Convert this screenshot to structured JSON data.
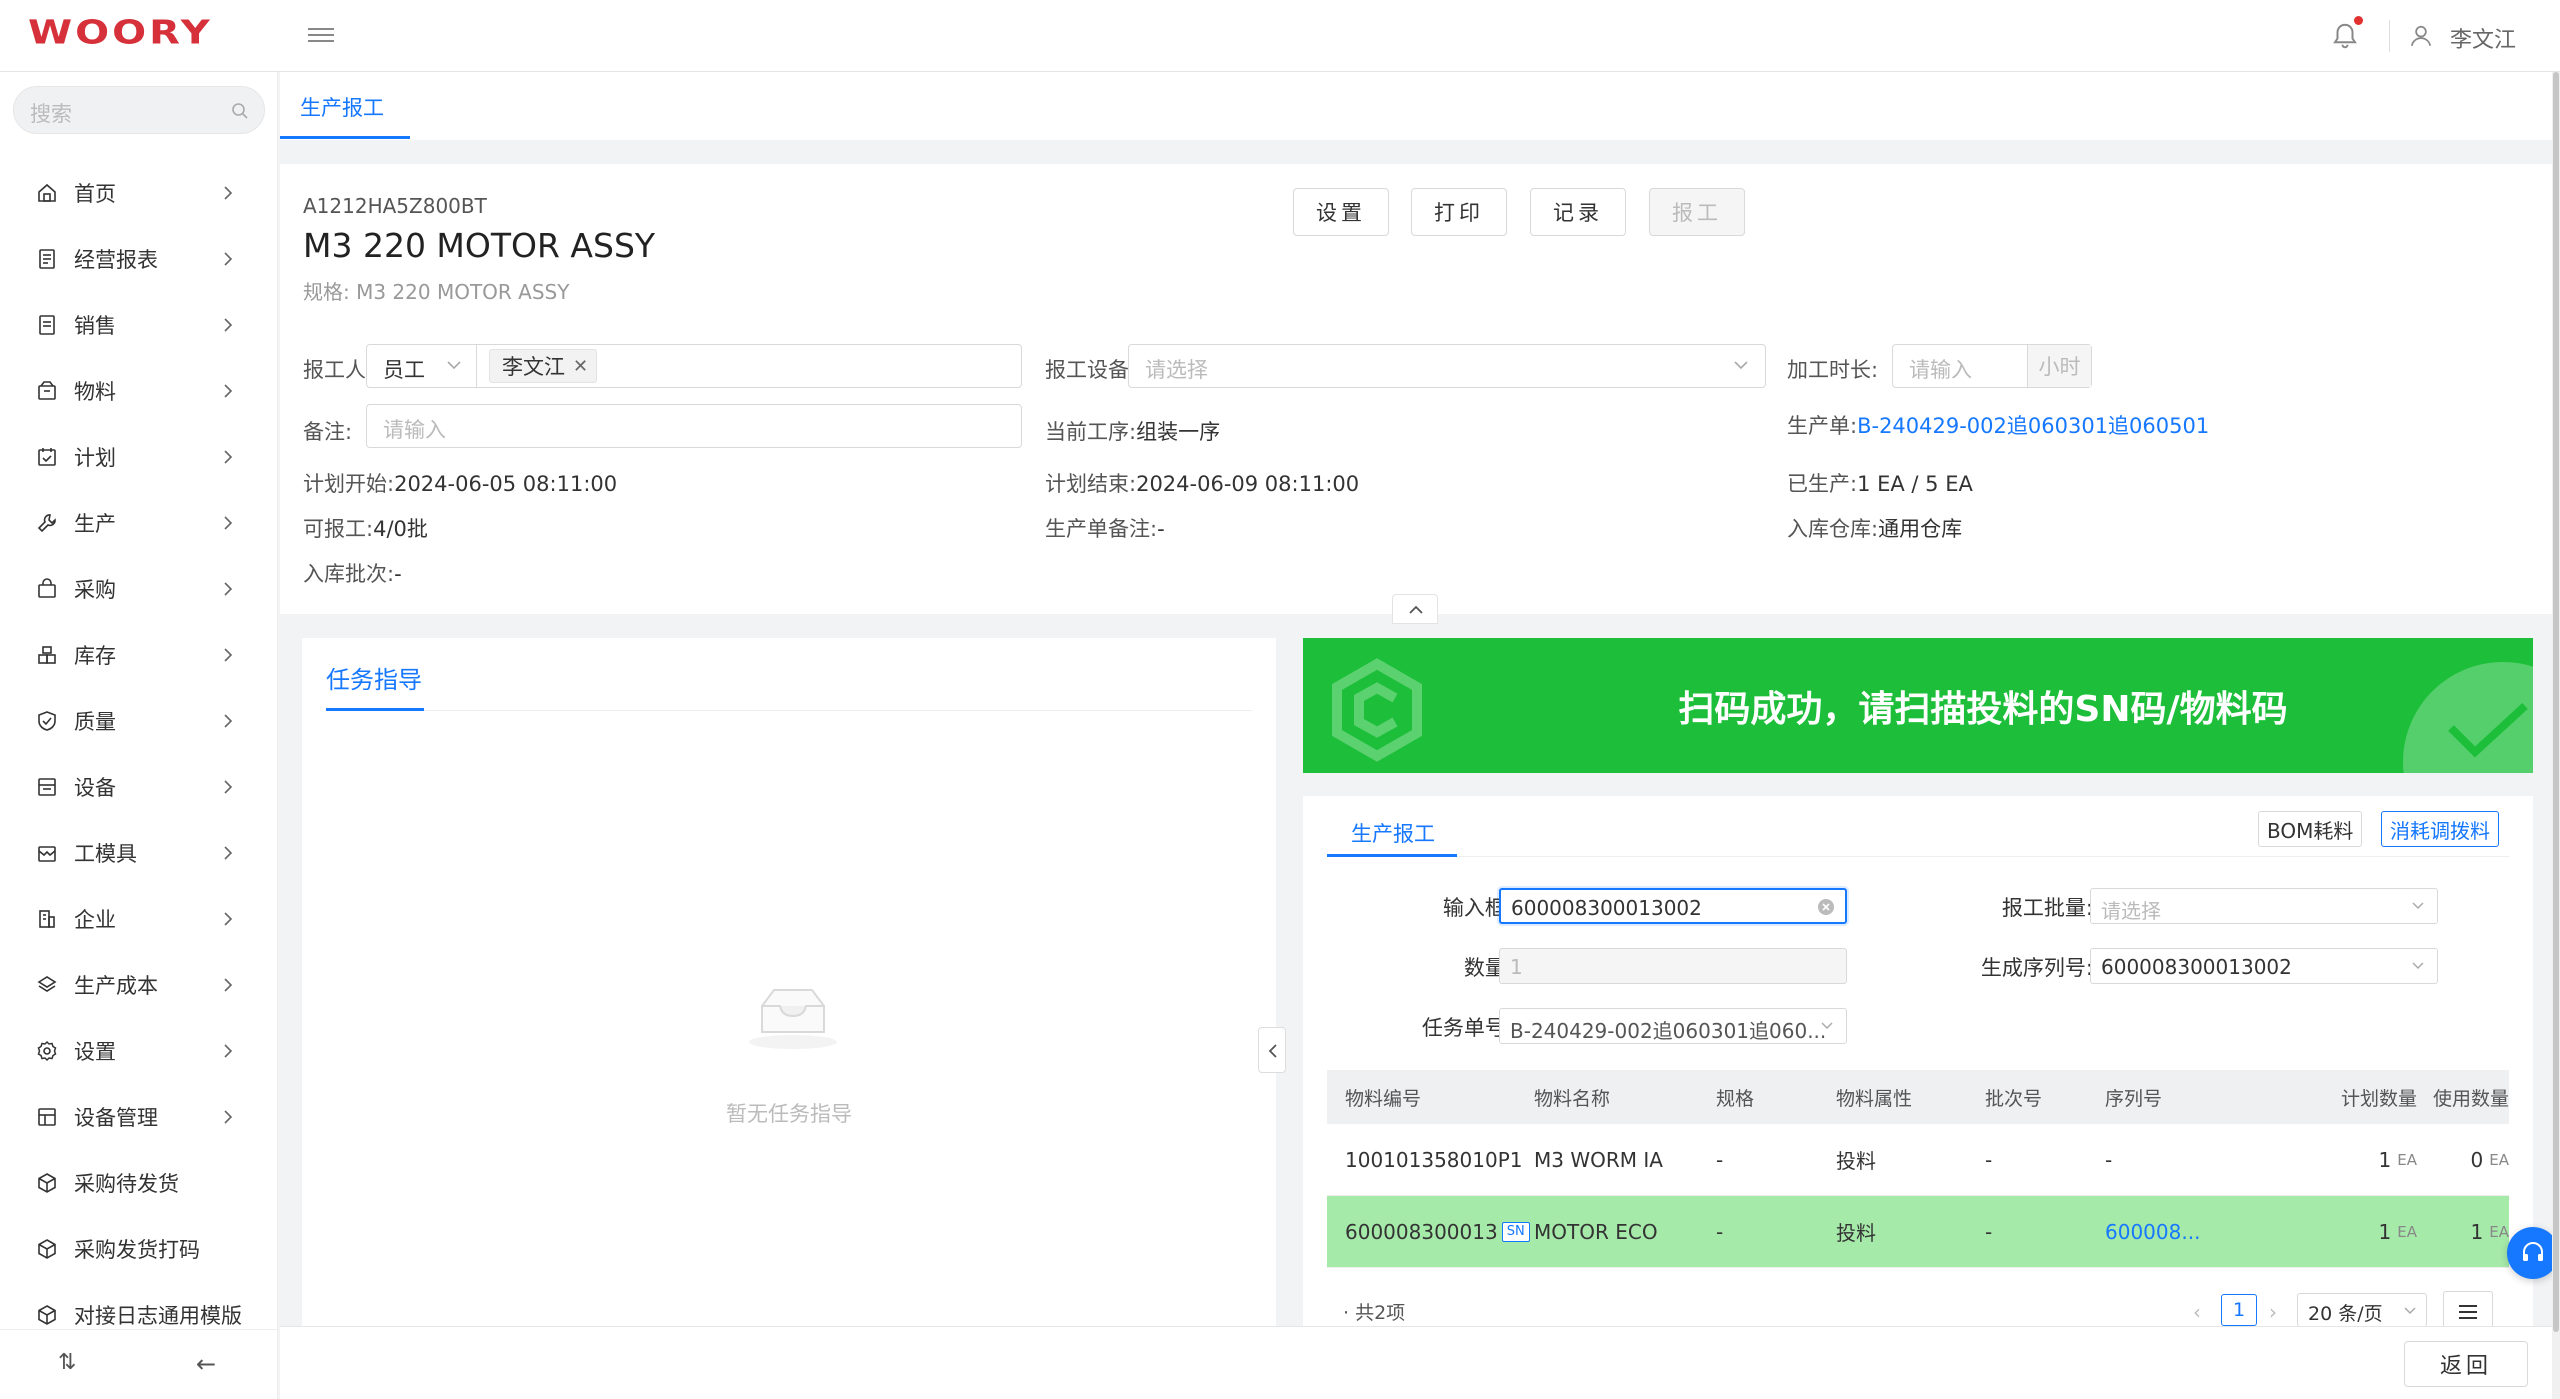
{
  "app": {
    "logo_text": "WOORY",
    "user_name": "李文江",
    "brand_color": "#d6303a",
    "accent_color": "#1677ff"
  },
  "sidebar": {
    "search_placeholder": "搜索",
    "items": [
      {
        "label": "首页",
        "icon": "home-icon",
        "has_children": true
      },
      {
        "label": "经营报表",
        "icon": "report-icon",
        "has_children": true
      },
      {
        "label": "销售",
        "icon": "document-icon",
        "has_children": true
      },
      {
        "label": "物料",
        "icon": "box-icon",
        "has_children": true
      },
      {
        "label": "计划",
        "icon": "calendar-check-icon",
        "has_children": true
      },
      {
        "label": "生产",
        "icon": "wrench-icon",
        "has_children": true
      },
      {
        "label": "采购",
        "icon": "bag-icon",
        "has_children": true
      },
      {
        "label": "库存",
        "icon": "warehouse-icon",
        "has_children": true
      },
      {
        "label": "质量",
        "icon": "shield-check-icon",
        "has_children": true
      },
      {
        "label": "设备",
        "icon": "device-icon",
        "has_children": true
      },
      {
        "label": "工模具",
        "icon": "mold-icon",
        "has_children": true
      },
      {
        "label": "企业",
        "icon": "building-icon",
        "has_children": true
      },
      {
        "label": "生产成本",
        "icon": "cost-icon",
        "has_children": true
      },
      {
        "label": "设置",
        "icon": "gear-icon",
        "has_children": true
      },
      {
        "label": "设备管理",
        "icon": "device-manage-icon",
        "has_children": true
      },
      {
        "label": "采购待发货",
        "icon": "cube-icon",
        "has_children": false
      },
      {
        "label": "采购发货打码",
        "icon": "cube-icon",
        "has_children": false
      },
      {
        "label": "对接日志通用模版",
        "icon": "cube-icon",
        "has_children": false
      }
    ],
    "footer_left": "⇅",
    "footer_right": "←"
  },
  "tabs": {
    "active": "生产报工"
  },
  "header": {
    "code": "A1212HA5Z800BT",
    "title": "M3 220 MOTOR ASSY",
    "spec": "规格: M3 220 MOTOR ASSY",
    "buttons": {
      "settings": "设置",
      "print": "打印",
      "records": "记录",
      "report": "报工"
    },
    "fields": {
      "reporter_label": "报工人",
      "reporter_type": "员工",
      "reporter_tag": "李文江",
      "device_label": "报工设备",
      "device_placeholder": "请选择",
      "duration_label": "加工时长:",
      "duration_placeholder": "请输入",
      "duration_unit": "小时",
      "remark_label": "备注:",
      "remark_placeholder": "请输入",
      "current_process_label": "当前工序:",
      "current_process_value": "组装一序",
      "order_label": "生产单:",
      "order_value": "B-240429-002追060301追060501",
      "plan_start_label": "计划开始:",
      "plan_start_value": "2024-06-05 08:11:00",
      "plan_end_label": "计划结束:",
      "plan_end_value": "2024-06-09 08:11:00",
      "produced_label": "已生产:",
      "produced_value": "1 EA / 5 EA",
      "reportable_label": "可报工:",
      "reportable_value": "4/0批",
      "order_remark_label": "生产单备注:",
      "order_remark_value": "-",
      "warehouse_label": "入库仓库:",
      "warehouse_value": "通用仓库",
      "batch_label": "入库批次:",
      "batch_value": "-"
    }
  },
  "task_card": {
    "title": "任务指导",
    "empty_text": "暂无任务指导"
  },
  "banner": {
    "message": "扫码成功，请扫描投料的SN码/物料码",
    "color": "#1dbf3a"
  },
  "report_card": {
    "tab": "生产报工",
    "btn_bom": "BOM耗料",
    "btn_consume": "消耗调拨料",
    "form": {
      "input_label": "输入框:",
      "input_value": "600008300013002",
      "batch_label": "报工批量:",
      "batch_placeholder": "请选择",
      "qty_label": "数量:",
      "qty_value": "1",
      "serial_label": "生成序列号:",
      "serial_value": "600008300013002",
      "task_label": "任务单号:",
      "task_value": "B-240429-002追060301追060..."
    },
    "table": {
      "headers": [
        "物料编号",
        "物料名称",
        "规格",
        "物料属性",
        "批次号",
        "序列号",
        "计划数量",
        "使用数量"
      ],
      "rows": [
        {
          "code": "100101358010P1",
          "sn": "",
          "name": "M3 WORM IA",
          "spec": "-",
          "attr": "投料",
          "batch": "-",
          "serial": "-",
          "plan_qty": "1",
          "plan_unit": "EA",
          "used_qty": "0",
          "used_unit": "EA"
        },
        {
          "code": "600008300013",
          "sn": "SN",
          "name": "MOTOR ECO",
          "spec": "-",
          "attr": "投料",
          "batch": "-",
          "serial": "600008...",
          "plan_qty": "1",
          "plan_unit": "EA",
          "used_qty": "1",
          "used_unit": "EA"
        }
      ]
    },
    "pager": {
      "total": "· 共2项",
      "current_page": "1",
      "page_size": "20 条/页"
    }
  },
  "bottom": {
    "back": "返回"
  }
}
